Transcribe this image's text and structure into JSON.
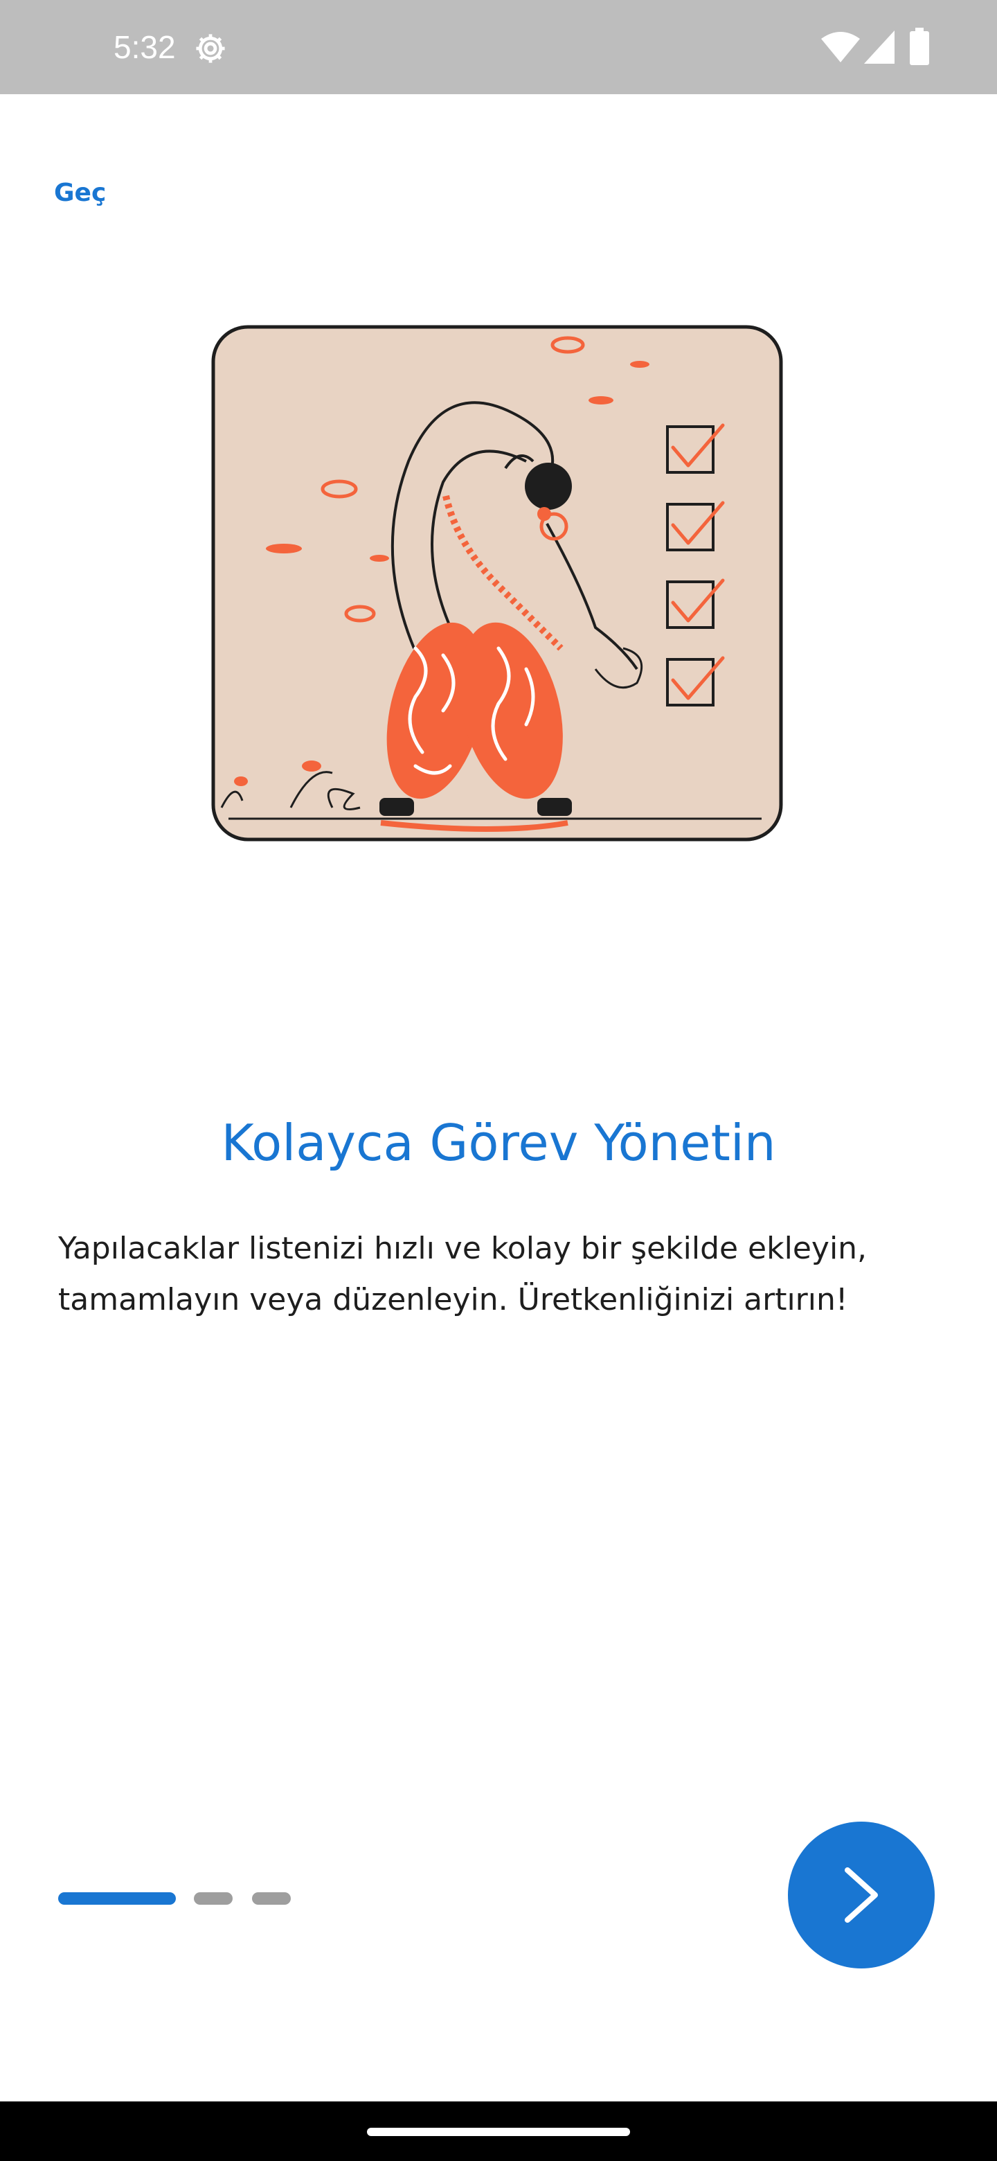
{
  "status_bar": {
    "time": "5:32",
    "icons": [
      "settings-gear-icon",
      "wifi-icon",
      "cell-signal-icon",
      "battery-icon"
    ]
  },
  "onboarding": {
    "skip_label": "Geç",
    "title": "Kolayca Görev Yönetin",
    "description": "Yapılacaklar listenizi hızlı ve kolay bir şekilde ekleyin, tamamlayın veya düzenleyin. Üretkenliğinizi artırın!",
    "page_count": 3,
    "current_page": 1,
    "next_icon": "chevron-right-icon"
  },
  "colors": {
    "accent": "#1976d2",
    "indicator_inactive": "#9e9e9e",
    "status_bar_bg": "#bdbdbd",
    "illustration_bg": "#e8d3c3",
    "illustration_orange": "#f4643c",
    "text": "#1e1e1e"
  }
}
